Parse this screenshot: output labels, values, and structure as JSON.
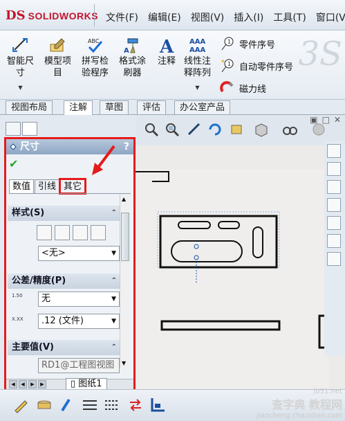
{
  "app": {
    "brand_prefix": "DS",
    "brand": "SOLIDWORKS"
  },
  "menu": [
    "文件(F)",
    "编辑(E)",
    "视图(V)",
    "插入(I)",
    "工具(T)",
    "窗口(V"
  ],
  "ribbon": {
    "large": [
      {
        "label1": "智能尺",
        "label2": "寸"
      },
      {
        "label1": "模型项",
        "label2": "目"
      },
      {
        "label1": "拼写检",
        "label2": "验程序"
      },
      {
        "label1": "格式涂",
        "label2": "刷器"
      },
      {
        "label1": "注释",
        "label2": ""
      },
      {
        "label1": "线性注",
        "label2": "释阵列"
      }
    ],
    "small": [
      "零件序号",
      "自动零件序号",
      "磁力线"
    ]
  },
  "tabs": [
    "视图布局",
    "注解",
    "草图",
    "评估",
    "办公室产品"
  ],
  "property_manager": {
    "title": "尺寸",
    "help": "?",
    "subtabs": [
      "数值",
      "引线",
      "其它"
    ],
    "sections": {
      "style": "样式(S)",
      "tolerance": "公差/精度(P)",
      "primary": "主要值(V)"
    },
    "style_value": "<无>",
    "tolerance_value": "无",
    "precision_value": ".12 (文件)",
    "tol_small_label1": "1.50",
    "tol_small_label2": "X.XX",
    "primary_value": "RD1@工程图视图"
  },
  "sheet_tab": "图纸1",
  "watermark": {
    "line1": "jb51.net",
    "line2": "查字典 教程网",
    "line3": "jiaocheng.chazidian.com"
  }
}
